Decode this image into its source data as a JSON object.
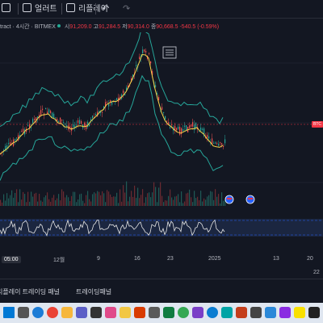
{
  "toolbar": {
    "alert_label": "얼러트",
    "replay_label": "리플레이",
    "undo_icon": "undo-icon",
    "redo_icon": "redo-icon"
  },
  "legend": {
    "symbol_suffix": "tract · 4시간 · BITMEX",
    "open_label": "시",
    "open": "91,209.0",
    "high_label": "고",
    "high": "91,284.5",
    "low_label": "저",
    "low": "90,314.0",
    "close_label": "종",
    "close": "90,668.5",
    "change": "-540.5 (-0.59%)"
  },
  "price_tag": "BTC",
  "time_axis": {
    "current": "05:00",
    "labels": [
      "12월",
      "9",
      "16",
      "23",
      "2025",
      "13",
      "20"
    ]
  },
  "corner_value": "22",
  "bottom_panel": {
    "tab1": "리플레이 트레이딩 패널",
    "tab2": "트레이딩패널"
  },
  "colors": {
    "background": "#131722",
    "bollinger": "#26a69a",
    "moving_average": "#f7d54a",
    "bull_candle": "#26a69a",
    "bear_candle": "#ef5350",
    "oscillator": "#e6e6e6"
  },
  "taskbar_icons": [
    "windows-icon",
    "search-icon",
    "edge-icon",
    "chrome-icon",
    "file-explorer-icon",
    "teams-icon",
    "store-icon",
    "app-icon",
    "folder-icon",
    "photos-icon",
    "calculator-icon",
    "spreadsheet-icon",
    "chrome-icon",
    "app-icon",
    "edge-icon",
    "app-icon",
    "app-icon",
    "notepad-icon",
    "app-icon",
    "app-icon",
    "kakaotalk-icon",
    "app-icon"
  ]
}
